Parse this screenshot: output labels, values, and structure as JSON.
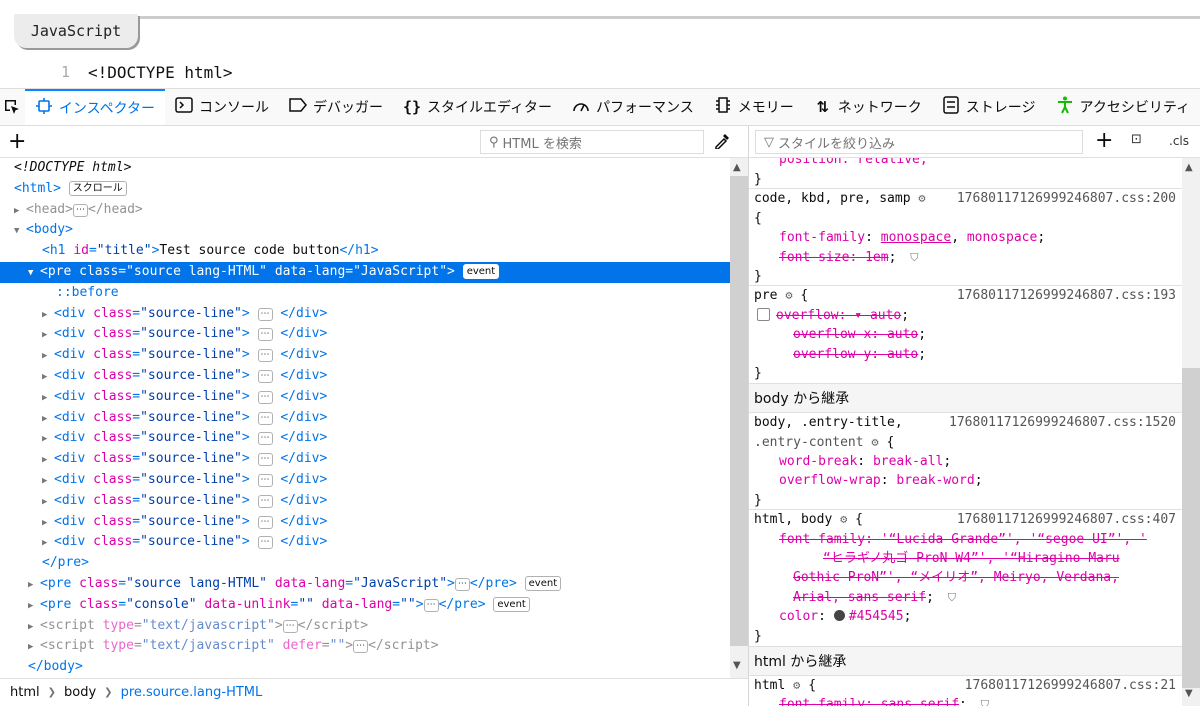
{
  "page": {
    "lang_button": "JavaScript",
    "code_line": {
      "number": "1",
      "text": "<!DOCTYPE html>"
    }
  },
  "toolbar": {
    "picker_icon": "element-picker-icon",
    "tabs": [
      {
        "label": "インスペクター",
        "icon": "inspector-icon",
        "active": true
      },
      {
        "label": "コンソール",
        "icon": "console-icon"
      },
      {
        "label": "デバッガー",
        "icon": "debugger-icon"
      },
      {
        "label": "スタイルエディター",
        "icon": "style-editor-icon"
      },
      {
        "label": "パフォーマンス",
        "icon": "performance-icon"
      },
      {
        "label": "メモリー",
        "icon": "memory-icon"
      },
      {
        "label": "ネットワーク",
        "icon": "network-icon"
      },
      {
        "label": "ストレージ",
        "icon": "storage-icon"
      },
      {
        "label": "アクセシビリティ",
        "icon": "accessibility-icon"
      }
    ]
  },
  "inspector": {
    "search_placeholder": "HTML を検索",
    "scroll_badge": "スクロール",
    "event_badge": "event",
    "h1_text": "Test source code button",
    "breadcrumb": [
      "html",
      "body",
      "pre.source.lang-HTML"
    ]
  },
  "rules": {
    "filter_placeholder": "スタイルを絞り込み",
    "cls_label": ".cls",
    "top_partial": "position: relative;",
    "code_rule": {
      "selector": "code, kbd, pre, samp",
      "source": "17680117126999246807.css:200",
      "font_family_prop": "font-family",
      "font_family_link": "monospace",
      "font_family_rest": "monospace",
      "font_size_prop": "font-size",
      "font_size_val": "1em"
    },
    "pre_rule": {
      "selector": "pre",
      "source": "17680117126999246807.css:193",
      "overflow_prop": "overflow",
      "overflow_val": "auto",
      "overflow_x_prop": "overflow-x",
      "overflow_y_prop": "overflow-y",
      "sub_val": "auto"
    },
    "inherit_body": "body から継承",
    "body_rule": {
      "selector1": "body, .entry-title,",
      "selector2": ".entry-content",
      "source": "17680117126999246807.css:1520",
      "word_break_prop": "word-break",
      "word_break_val": "break-all",
      "overflow_wrap_prop": "overflow-wrap",
      "overflow_wrap_val": "break-word"
    },
    "htmlbody_rule": {
      "selector": "html, body",
      "source": "17680117126999246807.css:407",
      "font_family_prop": "font-family",
      "ff1": "'“Lucida Grande”', '“segoe UI”', '",
      "ff2": "“ヒラギノ丸ゴ ProN W4”', '“Hiragino Maru",
      "ff3": "Gothic ProN”', “メイリオ”, Meiryo, Verdana,",
      "ff4": "Arial, sans-serif",
      "color_prop": "color",
      "color_val": "#454545"
    },
    "inherit_html": "html から継承",
    "html_rule": {
      "selector": "html",
      "source": "17680117126999246807.css:21",
      "font_family_prop": "font-family",
      "font_family_val": "sans-serif"
    }
  },
  "colors": {
    "accent": "#0074e8",
    "selection": "#0074e8",
    "prop": "#dd00a9"
  }
}
